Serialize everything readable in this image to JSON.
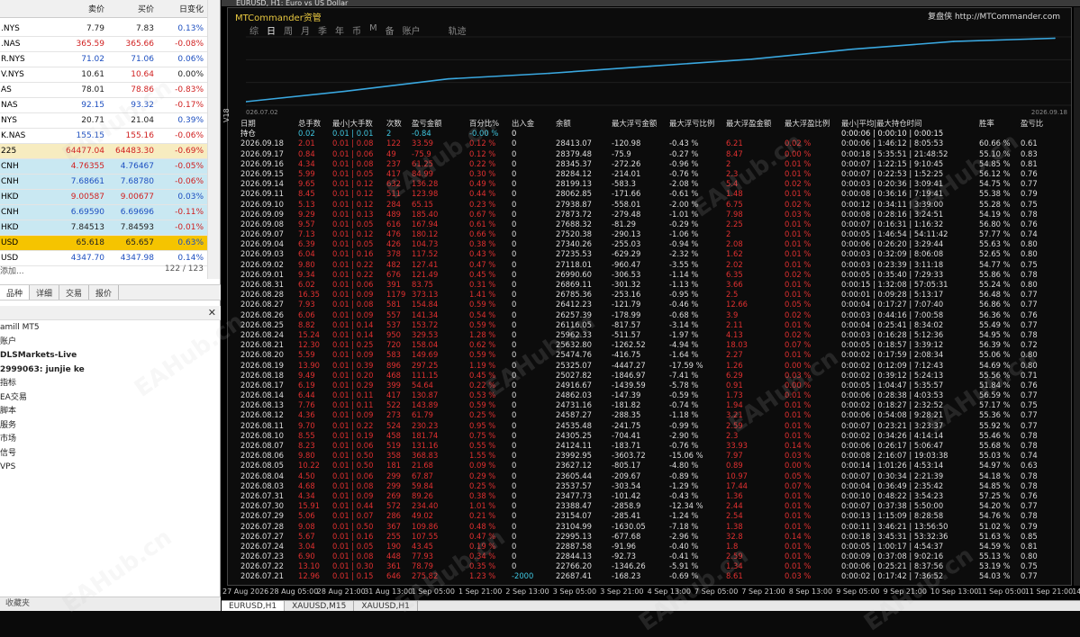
{
  "market_watch": {
    "columns": [
      "",
      "卖价",
      "买价",
      "日变化"
    ],
    "rows": [
      {
        "symbol": ".NYS",
        "bid": "7.79",
        "ask": "7.83",
        "change": "0.13%",
        "bid_color": "#222",
        "ask_color": "#222",
        "chg_color": "#1d4fc0",
        "bg": "#ffffff"
      },
      {
        "symbol": ".NAS",
        "bid": "365.59",
        "ask": "365.66",
        "change": "-0.08%",
        "bid_color": "#d02020",
        "ask_color": "#d02020",
        "chg_color": "#d02020",
        "bg": "#ffffff"
      },
      {
        "symbol": "R.NYS",
        "bid": "71.02",
        "ask": "71.06",
        "change": "0.06%",
        "bid_color": "#1d4fc0",
        "ask_color": "#1d4fc0",
        "chg_color": "#1d4fc0",
        "bg": "#ffffff"
      },
      {
        "symbol": "V.NYS",
        "bid": "10.61",
        "ask": "10.64",
        "change": "0.00%",
        "bid_color": "#222",
        "ask_color": "#d02020",
        "chg_color": "#222",
        "bg": "#ffffff"
      },
      {
        "symbol": "AS",
        "bid": "78.01",
        "ask": "78.86",
        "change": "-0.83%",
        "bid_color": "#222",
        "ask_color": "#d02020",
        "chg_color": "#d02020",
        "bg": "#ffffff"
      },
      {
        "symbol": "NAS",
        "bid": "92.15",
        "ask": "93.32",
        "change": "-0.17%",
        "bid_color": "#1d4fc0",
        "ask_color": "#1d4fc0",
        "chg_color": "#d02020",
        "bg": "#ffffff"
      },
      {
        "symbol": "NYS",
        "bid": "20.71",
        "ask": "21.04",
        "change": "0.39%",
        "bid_color": "#222",
        "ask_color": "#222",
        "chg_color": "#1d4fc0",
        "bg": "#ffffff"
      },
      {
        "symbol": "K.NAS",
        "bid": "155.15",
        "ask": "155.16",
        "change": "-0.06%",
        "bid_color": "#1d4fc0",
        "ask_color": "#d02020",
        "chg_color": "#d02020",
        "bg": "#ffffff"
      },
      {
        "symbol": "225",
        "bid": "64477.04",
        "ask": "64483.30",
        "change": "-0.69%",
        "bid_color": "#d02020",
        "ask_color": "#d02020",
        "chg_color": "#d02020",
        "bg": "#f7ecc0"
      },
      {
        "symbol": "CNH",
        "bid": "4.76355",
        "ask": "4.76467",
        "change": "-0.05%",
        "bid_color": "#d02020",
        "ask_color": "#1d4fc0",
        "chg_color": "#d02020",
        "bg": "#c9e8f2"
      },
      {
        "symbol": "CNH",
        "bid": "7.68661",
        "ask": "7.68780",
        "change": "-0.06%",
        "bid_color": "#1d4fc0",
        "ask_color": "#1d4fc0",
        "chg_color": "#d02020",
        "bg": "#c9e8f2"
      },
      {
        "symbol": "HKD",
        "bid": "9.00587",
        "ask": "9.00677",
        "change": "0.03%",
        "bid_color": "#d02020",
        "ask_color": "#d02020",
        "chg_color": "#1d4fc0",
        "bg": "#c9e8f2"
      },
      {
        "symbol": "CNH",
        "bid": "6.69590",
        "ask": "6.69696",
        "change": "-0.11%",
        "bid_color": "#1d4fc0",
        "ask_color": "#1d4fc0",
        "chg_color": "#d02020",
        "bg": "#c9e8f2"
      },
      {
        "symbol": "HKD",
        "bid": "7.84513",
        "ask": "7.84593",
        "change": "-0.01%",
        "bid_color": "#222",
        "ask_color": "#222",
        "chg_color": "#d02020",
        "bg": "#c9e8f2"
      },
      {
        "symbol": "USD",
        "bid": "65.618",
        "ask": "65.657",
        "change": "0.63%",
        "bid_color": "#222",
        "ask_color": "#222",
        "chg_color": "#1d4fc0",
        "bg": "#f5c400"
      },
      {
        "symbol": "USD",
        "bid": "4347.70",
        "ask": "4347.98",
        "change": "0.14%",
        "bid_color": "#1d4fc0",
        "ask_color": "#1d4fc0",
        "chg_color": "#1d4fc0",
        "bg": "#ffffff"
      }
    ],
    "footer_left": "添加...",
    "footer_right": "122 / 123",
    "tabs": [
      "品种",
      "详细",
      "交易",
      "报价"
    ]
  },
  "navigator": {
    "close": "✕",
    "items": [
      {
        "label": "amill MT5",
        "bold": false
      },
      {
        "label": "账户",
        "bold": false
      },
      {
        "label": "DLSMarkets-Live",
        "bold": true
      },
      {
        "label": "2999063: junjie ke",
        "bold": true
      },
      {
        "label": "指标",
        "bold": false
      },
      {
        "label": "EA交易",
        "bold": false
      },
      {
        "label": "脚本",
        "bold": false
      },
      {
        "label": "服务",
        "bold": false
      },
      {
        "label": "市场",
        "bold": false
      },
      {
        "label": "信号",
        "bold": false
      },
      {
        "label": "VPS",
        "bold": false
      }
    ],
    "bottom_tab": "收藏夹"
  },
  "chart_window": {
    "title": "EURUSD, H1: Euro vs US Dollar",
    "panel_title": "MTCommander资管",
    "brand": "复盘侠 http://MTCommander.com",
    "tabs": [
      "综",
      "日",
      "周",
      "月",
      "季",
      "年",
      "币",
      "M",
      "备",
      "账户",
      "轨迹"
    ],
    "active_tab": "日",
    "eq_start_label": "026.07.02",
    "eq_end_label": "2026.09.18",
    "side_label": "V18",
    "columns": [
      "日期",
      "总手数",
      "最小|大手数",
      "次数",
      "盈亏金额",
      "百分比%",
      "出入金",
      "余额",
      "最大浮亏金额",
      "最大浮亏比例",
      "最大浮盈金额",
      "最大浮盈比例",
      "最小|平均|最大持仓时间",
      "胜率",
      "盈亏比"
    ],
    "position_row": {
      "label": "持仓",
      "lots": "0.02",
      "minmax": "0.01 | 0.01",
      "count": "2",
      "pnl": "-0.84",
      "pct": "-0.00 %",
      "dep": "0",
      "bal": "",
      "maxfl": "",
      "maxflp": "",
      "maxfp": "",
      "maxfpp": "",
      "hold": "0:00:06 | 0:00:10 | 0:00:15",
      "win": "",
      "pf": ""
    },
    "x_axis_labels": [
      "27 Aug 2026",
      "28 Aug 05:00",
      "28 Aug 21:00",
      "31 Aug 13:00",
      "1 Sep 05:00",
      "1 Sep 21:00",
      "2 Sep 13:00",
      "3 Sep 05:00",
      "3 Sep 21:00",
      "4 Sep 13:00",
      "7 Sep 05:00",
      "7 Sep 21:00",
      "8 Sep 13:00",
      "9 Sep 05:00",
      "9 Sep 21:00",
      "10 Sep 13:00",
      "11 Sep 05:00",
      "11 Sep 21:00",
      "14 Sep 13:00"
    ],
    "bottom_tabs": [
      "EURUSD,H1",
      "XAUUSD,M15",
      "XAUUSD,H1"
    ],
    "watermark": "EAHub.cn",
    "line_color": "#3aa8e0"
  },
  "chart_data": {
    "type": "line",
    "x": [
      "2026.07.02",
      "2026.07.10",
      "2026.07.20",
      "2026.07.31",
      "2026.08.10",
      "2026.08.20",
      "2026.08.31",
      "2026.09.10",
      "2026.09.18"
    ],
    "y": [
      19500,
      21000,
      22700,
      23480,
      24480,
      25470,
      26870,
      27950,
      28413
    ],
    "title": "",
    "xlabel": "",
    "ylabel": ""
  },
  "table_rows": [
    [
      "2026.09.18",
      "2.01",
      "0.01 | 0.08",
      "122",
      "33.59",
      "0.12 %",
      "0",
      "28413.07",
      "-120.98",
      "-0.43 %",
      "6.21",
      "0.02 %",
      "0:00:06 | 1:46:12 | 8:05:53",
      "60.66 %",
      "0.61"
    ],
    [
      "2026.09.17",
      "0.84",
      "0.01 | 0.06",
      "49",
      "-75.9",
      "0.12 %",
      "0",
      "28379.48",
      "-75.9",
      "-0.27 %",
      "8.47",
      "0.00 %",
      "0:00:18 | 5:35:51 | 21:48:52",
      "55.10 %",
      "0.83"
    ],
    [
      "2026.09.16",
      "4.34",
      "0.01 | 0.08",
      "237",
      "61.25",
      "0.22 %",
      "0",
      "28345.37",
      "-272.26",
      "-0.96 %",
      "2",
      "0.01 %",
      "0:00:07 | 1:22:15 | 9:10:45",
      "54.85 %",
      "0.81"
    ],
    [
      "2026.09.15",
      "5.99",
      "0.01 | 0.05",
      "417",
      "84.99",
      "0.30 %",
      "0",
      "28284.12",
      "-214.01",
      "-0.76 %",
      "2.3",
      "0.01 %",
      "0:00:07 | 0:22:53 | 1:52:25",
      "56.12 %",
      "0.76"
    ],
    [
      "2026.09.14",
      "9.65",
      "0.01 | 0.12",
      "632",
      "136.28",
      "0.49 %",
      "0",
      "28199.13",
      "-583.3",
      "-2.08 %",
      "5.4",
      "0.02 %",
      "0:00:03 | 0:20:36 | 3:09:41",
      "54.75 %",
      "0.77"
    ],
    [
      "2026.09.11",
      "8.45",
      "0.01 | 0.12",
      "511",
      "123.98",
      "0.44 %",
      "0",
      "28062.85",
      "-171.66",
      "-0.61 %",
      "1.48",
      "0.01 %",
      "0:00:08 | 0:36:16 | 7:19:41",
      "55.38 %",
      "0.79"
    ],
    [
      "2026.09.10",
      "5.13",
      "0.01 | 0.12",
      "284",
      "65.15",
      "0.23 %",
      "0",
      "27938.87",
      "-558.01",
      "-2.00 %",
      "6.75",
      "0.02 %",
      "0:00:12 | 0:34:11 | 3:39:00",
      "55.28 %",
      "0.75"
    ],
    [
      "2026.09.09",
      "9.29",
      "0.01 | 0.13",
      "489",
      "185.40",
      "0.67 %",
      "0",
      "27873.72",
      "-279.48",
      "-1.01 %",
      "7.98",
      "0.03 %",
      "0:00:08 | 0:28:16 | 3:24:51",
      "54.19 %",
      "0.78"
    ],
    [
      "2026.09.08",
      "9.57",
      "0.01 | 0.05",
      "616",
      "167.94",
      "0.61 %",
      "0",
      "27688.32",
      "-81.29",
      "-0.29 %",
      "2.25",
      "0.01 %",
      "0:00:07 | 0:16:31 | 1:16:32",
      "56.80 %",
      "0.76"
    ],
    [
      "2026.09.07",
      "7.13",
      "0.01 | 0.12",
      "476",
      "180.12",
      "0.66 %",
      "0",
      "27520.38",
      "-290.13",
      "-1.06 %",
      "2",
      "0.01 %",
      "0:00:05 | 1:46:54 | 54:11:42",
      "57.77 %",
      "0.74"
    ],
    [
      "2026.09.04",
      "6.39",
      "0.01 | 0.05",
      "426",
      "104.73",
      "0.38 %",
      "0",
      "27340.26",
      "-255.03",
      "-0.94 %",
      "2.08",
      "0.01 %",
      "0:00:06 | 0:26:20 | 3:29:44",
      "55.63 %",
      "0.80"
    ],
    [
      "2026.09.03",
      "6.04",
      "0.01 | 0.16",
      "378",
      "117.52",
      "0.43 %",
      "0",
      "27235.53",
      "-629.29",
      "-2.32 %",
      "1.62",
      "0.01 %",
      "0:00:03 | 0:32:09 | 8:06:08",
      "52.65 %",
      "0.80"
    ],
    [
      "2026.09.02",
      "9.80",
      "0.01 | 0.22",
      "482",
      "127.41",
      "0.47 %",
      "0",
      "27118.01",
      "-960.47",
      "-3.55 %",
      "2.02",
      "0.01 %",
      "0:00:03 | 0:23:39 | 3:11:18",
      "54.77 %",
      "0.75"
    ],
    [
      "2026.09.01",
      "9.34",
      "0.01 | 0.22",
      "676",
      "121.49",
      "0.45 %",
      "0",
      "26990.60",
      "-306.53",
      "-1.14 %",
      "6.35",
      "0.02 %",
      "0:00:05 | 0:35:40 | 7:29:33",
      "55.86 %",
      "0.78"
    ],
    [
      "2026.08.31",
      "6.02",
      "0.01 | 0.06",
      "391",
      "83.75",
      "0.31 %",
      "0",
      "26869.11",
      "-301.32",
      "-1.13 %",
      "3.66",
      "0.01 %",
      "0:00:15 | 1:32:08 | 57:05:31",
      "55.24 %",
      "0.80"
    ],
    [
      "2026.08.28",
      "16.35",
      "0.01 | 0.09",
      "1179",
      "373.13",
      "1.41 %",
      "0",
      "26785.36",
      "-253.16",
      "-0.95 %",
      "2.5",
      "0.01 %",
      "0:00:01 | 0:09:28 | 5:13:17",
      "56.48 %",
      "0.77"
    ],
    [
      "2026.08.27",
      "7.93",
      "0.01 | 0.08",
      "581",
      "154.84",
      "0.59 %",
      "0",
      "26412.23",
      "-121.79",
      "-0.46 %",
      "12.66",
      "0.05 %",
      "0:00:04 | 0:17:27 | 7:07:40",
      "56.86 %",
      "0.77"
    ],
    [
      "2026.08.26",
      "6.06",
      "0.01 | 0.09",
      "557",
      "141.34",
      "0.54 %",
      "0",
      "26257.39",
      "-178.99",
      "-0.68 %",
      "3.9",
      "0.02 %",
      "0:00:03 | 0:44:16 | 7:00:58",
      "56.36 %",
      "0.76"
    ],
    [
      "2026.08.25",
      "8.82",
      "0.01 | 0.14",
      "537",
      "153.72",
      "0.59 %",
      "0",
      "26116.05",
      "-817.57",
      "-3.14 %",
      "2.11",
      "0.01 %",
      "0:00:04 | 0:25:41 | 8:34:02",
      "55.49 %",
      "0.77"
    ],
    [
      "2026.08.24",
      "15.24",
      "0.01 | 0.14",
      "950",
      "329.53",
      "1.28 %",
      "0",
      "25962.33",
      "-511.57",
      "-1.97 %",
      "4.13",
      "0.02 %",
      "0:00:03 | 0:16:28 | 5:12:36",
      "54.95 %",
      "0.78"
    ],
    [
      "2026.08.21",
      "12.30",
      "0.01 | 0.25",
      "720",
      "158.04",
      "0.62 %",
      "0",
      "25632.80",
      "-1262.52",
      "-4.94 %",
      "18.03",
      "0.07 %",
      "0:00:05 | 0:18:57 | 3:39:12",
      "56.39 %",
      "0.72"
    ],
    [
      "2026.08.20",
      "5.59",
      "0.01 | 0.09",
      "583",
      "149.69",
      "0.59 %",
      "0",
      "25474.76",
      "-416.75",
      "-1.64 %",
      "2.27",
      "0.01 %",
      "0:00:02 | 0:17:59 | 2:08:34",
      "55.06 %",
      "0.80"
    ],
    [
      "2026.08.19",
      "13.90",
      "0.01 | 0.39",
      "896",
      "297.25",
      "1.19 %",
      "0",
      "25325.07",
      "-4447.27",
      "-17.59 %",
      "1.26",
      "0.00 %",
      "0:00:02 | 0:12:09 | 7:12:43",
      "54.69 %",
      "0.80"
    ],
    [
      "2026.08.18",
      "9.49",
      "0.01 | 0.20",
      "468",
      "111.15",
      "0.45 %",
      "0",
      "25027.82",
      "-1846.97",
      "-7.41 %",
      "6.29",
      "0.03 %",
      "0:00:02 | 0:39:12 | 5:24:13",
      "55.56 %",
      "0.71"
    ],
    [
      "2026.08.17",
      "6.19",
      "0.01 | 0.29",
      "399",
      "54.64",
      "0.22 %",
      "0",
      "24916.67",
      "-1439.59",
      "-5.78 %",
      "0.91",
      "0.00 %",
      "0:00:05 | 1:04:47 | 5:35:57",
      "51.84 %",
      "0.76"
    ],
    [
      "2026.08.14",
      "6.44",
      "0.01 | 0.11",
      "417",
      "130.87",
      "0.53 %",
      "0",
      "24862.03",
      "-147.39",
      "-0.59 %",
      "1.73",
      "0.01 %",
      "0:00:06 | 0:28:38 | 4:03:53",
      "56.59 %",
      "0.77"
    ],
    [
      "2026.08.13",
      "7.76",
      "0.01 | 0.11",
      "522",
      "143.89",
      "0.59 %",
      "0",
      "24731.16",
      "-181.82",
      "-0.74 %",
      "1.94",
      "0.01 %",
      "0:00:02 | 0:18:27 | 2:32:52",
      "57.17 %",
      "0.75"
    ],
    [
      "2026.08.12",
      "4.36",
      "0.01 | 0.09",
      "273",
      "61.79",
      "0.25 %",
      "0",
      "24587.27",
      "-288.35",
      "-1.18 %",
      "3.21",
      "0.01 %",
      "0:00:06 | 0:54:08 | 9:28:21",
      "55.36 %",
      "0.77"
    ],
    [
      "2026.08.11",
      "9.70",
      "0.01 | 0.22",
      "524",
      "230.23",
      "0.95 %",
      "0",
      "24535.48",
      "-241.75",
      "-0.99 %",
      "2.59",
      "0.01 %",
      "0:00:07 | 0:23:21 | 3:23:37",
      "55.92 %",
      "0.77"
    ],
    [
      "2026.08.10",
      "8.55",
      "0.01 | 0.19",
      "458",
      "181.74",
      "0.75 %",
      "0",
      "24305.25",
      "-704.41",
      "-2.90 %",
      "2.3",
      "0.01 %",
      "0:00:02 | 0:34:26 | 4:14:14",
      "55.46 %",
      "0.78"
    ],
    [
      "2026.08.07",
      "8.23",
      "0.01 | 0.06",
      "519",
      "131.16",
      "0.55 %",
      "0",
      "24124.11",
      "-183.71",
      "-0.76 %",
      "33.93",
      "0.14 %",
      "0:00:06 | 0:26:17 | 5:06:47",
      "55.68 %",
      "0.78"
    ],
    [
      "2026.08.06",
      "9.80",
      "0.01 | 0.50",
      "358",
      "368.83",
      "1.55 %",
      "0",
      "23992.95",
      "-3603.72",
      "-15.06 %",
      "7.97",
      "0.03 %",
      "0:00:08 | 2:16:07 | 19:03:38",
      "55.03 %",
      "0.74"
    ],
    [
      "2026.08.05",
      "10.22",
      "0.01 | 0.50",
      "181",
      "21.68",
      "0.09 %",
      "0",
      "23627.12",
      "-805.17",
      "-4.80 %",
      "0.89",
      "0.00 %",
      "0:00:14 | 1:01:26 | 4:53:14",
      "54.97 %",
      "0.63"
    ],
    [
      "2026.08.04",
      "4.50",
      "0.01 | 0.06",
      "299",
      "67.87",
      "0.29 %",
      "0",
      "23605.44",
      "-209.67",
      "-0.89 %",
      "10.97",
      "0.05 %",
      "0:00:07 | 0:30:34 | 2:21:39",
      "54.18 %",
      "0.78"
    ],
    [
      "2026.08.03",
      "4.68",
      "0.01 | 0.08",
      "299",
      "59.84",
      "0.25 %",
      "0",
      "23537.57",
      "-303.54",
      "-1.29 %",
      "17.44",
      "0.07 %",
      "0:00:04 | 0:36:49 | 2:35:42",
      "54.85 %",
      "0.78"
    ],
    [
      "2026.07.31",
      "4.34",
      "0.01 | 0.09",
      "269",
      "89.26",
      "0.38 %",
      "0",
      "23477.73",
      "-101.42",
      "-0.43 %",
      "1.36",
      "0.01 %",
      "0:00:10 | 0:48:22 | 3:54:23",
      "57.25 %",
      "0.76"
    ],
    [
      "2026.07.30",
      "15.91",
      "0.01 | 0.44",
      "572",
      "234.40",
      "1.01 %",
      "0",
      "23388.47",
      "-2858.9",
      "-12.34 %",
      "2.44",
      "0.01 %",
      "0:00:07 | 0:37:38 | 5:50:00",
      "54.20 %",
      "0.77"
    ],
    [
      "2026.07.29",
      "5.06",
      "0.01 | 0.07",
      "286",
      "49.02",
      "0.21 %",
      "0",
      "23154.07",
      "-285.41",
      "-1.24 %",
      "2.54",
      "0.01 %",
      "0:00:13 | 1:15:09 | 8:28:58",
      "54.76 %",
      "0.78"
    ],
    [
      "2026.07.28",
      "9.08",
      "0.01 | 0.50",
      "367",
      "109.86",
      "0.48 %",
      "0",
      "23104.99",
      "-1630.05",
      "-7.18 %",
      "1.38",
      "0.01 %",
      "0:00:11 | 3:46:21 | 13:56:50",
      "51.02 %",
      "0.79"
    ],
    [
      "2026.07.27",
      "5.67",
      "0.01 | 0.16",
      "255",
      "107.55",
      "0.47 %",
      "0",
      "22995.13",
      "-677.68",
      "-2.96 %",
      "32.8",
      "0.14 %",
      "0:00:18 | 3:45:31 | 53:32:36",
      "51.63 %",
      "0.85"
    ],
    [
      "2026.07.24",
      "3.04",
      "0.01 | 0.05",
      "190",
      "43.45",
      "0.19 %",
      "0",
      "22887.58",
      "-91.96",
      "-0.40 %",
      "1.8",
      "0.01 %",
      "0:00:05 | 1:00:17 | 4:54:37",
      "54.59 %",
      "0.81"
    ],
    [
      "2026.07.23",
      "6.90",
      "0.01 | 0.08",
      "448",
      "77.93",
      "0.34 %",
      "0",
      "22844.13",
      "-92.73",
      "-0.41 %",
      "2.59",
      "0.01 %",
      "0:00:09 | 0:37:08 | 9:02:16",
      "55.13 %",
      "0.80"
    ],
    [
      "2026.07.22",
      "13.10",
      "0.01 | 0.30",
      "361",
      "78.79",
      "0.35 %",
      "0",
      "22766.20",
      "-1346.26",
      "-5.91 %",
      "1.34",
      "0.01 %",
      "0:00:06 | 0:25:21 | 8:37:56",
      "53.19 %",
      "0.75"
    ],
    [
      "2026.07.21",
      "12.96",
      "0.01 | 0.15",
      "646",
      "275.82",
      "1.23 %",
      "-2000",
      "22687.41",
      "-168.23",
      "-0.69 %",
      "8.61",
      "0.03 %",
      "0:00:02 | 0:17:42 | 7:36:52",
      "54.03 %",
      "0.77"
    ]
  ]
}
